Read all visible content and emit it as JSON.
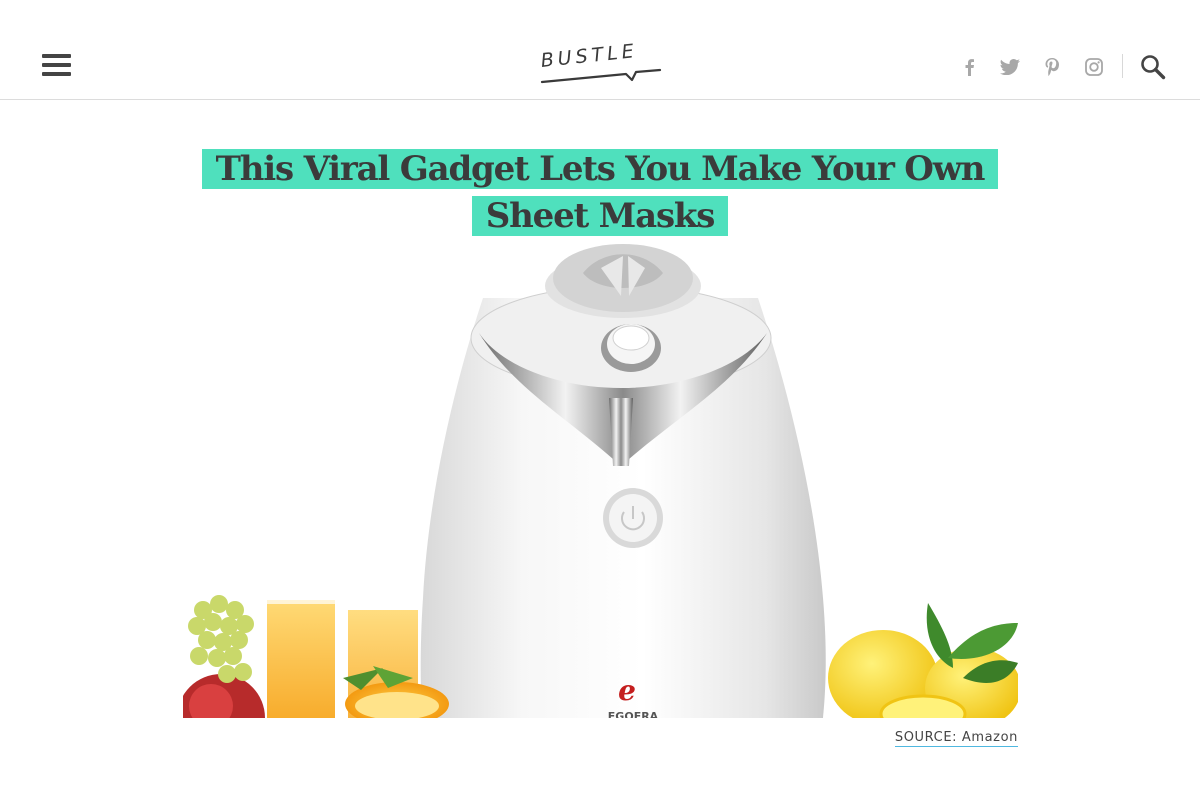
{
  "header": {
    "logo_text": "BUSTLE",
    "social_icons": [
      "facebook-icon",
      "twitter-icon",
      "pinterest-icon",
      "instagram-icon"
    ],
    "search_icon": "search-icon",
    "menu_icon": "hamburger-menu-icon"
  },
  "article": {
    "title": "This Viral Gadget Lets You Make Your Own Sheet Masks",
    "highlight_color": "#4fe0bd",
    "image_brand_text": "EGOERA",
    "caption": "SOURCE: Amazon",
    "caption_underline_color": "#4fb8e0"
  }
}
